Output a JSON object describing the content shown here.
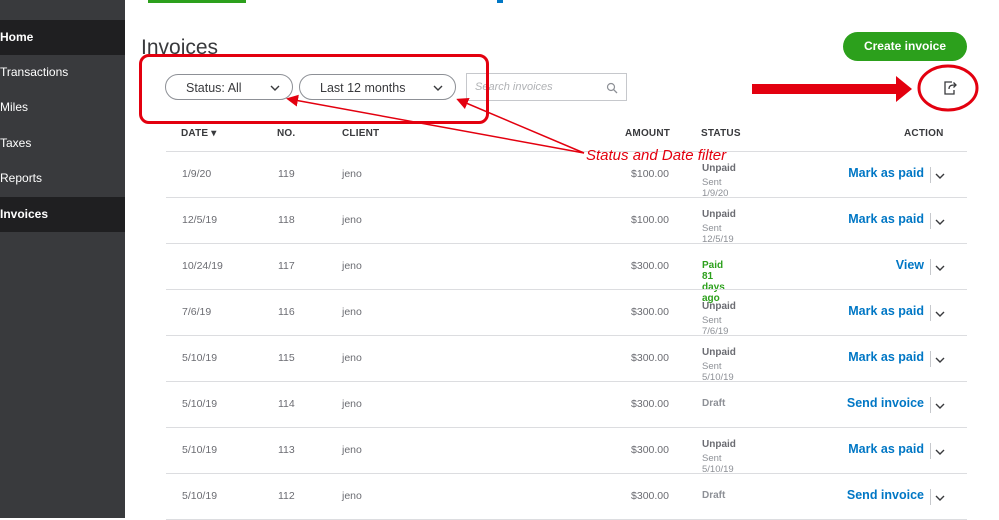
{
  "app": {
    "page_title": "Invoices",
    "create_button": "Create invoice"
  },
  "sidebar": {
    "items": [
      {
        "label": "Home"
      },
      {
        "label": "Transactions"
      },
      {
        "label": "Miles"
      },
      {
        "label": "Taxes"
      },
      {
        "label": "Reports"
      },
      {
        "label": "Invoices"
      }
    ]
  },
  "filters": {
    "status": "Status: All",
    "date_range": "Last 12 months",
    "search_placeholder": "Search invoices"
  },
  "table": {
    "columns": [
      "DATE ▾",
      "NO.",
      "CLIENT",
      "AMOUNT",
      "STATUS",
      "ACTION"
    ],
    "rows": [
      {
        "date": "1/9/20",
        "no": "119",
        "client": "jeno",
        "amount": "$100.00",
        "status": "Unpaid",
        "sub": "Sent 1/9/20",
        "action": "Mark as paid"
      },
      {
        "date": "12/5/19",
        "no": "118",
        "client": "jeno",
        "amount": "$100.00",
        "status": "Unpaid",
        "sub": "Sent 12/5/19",
        "action": "Mark as paid"
      },
      {
        "date": "10/24/19",
        "no": "117",
        "client": "jeno",
        "amount": "$300.00",
        "status": "Paid 81 days ago",
        "sub": "",
        "action": "View"
      },
      {
        "date": "7/6/19",
        "no": "116",
        "client": "jeno",
        "amount": "$300.00",
        "status": "Unpaid",
        "sub": "Sent 7/6/19",
        "action": "Mark as paid"
      },
      {
        "date": "5/10/19",
        "no": "115",
        "client": "jeno",
        "amount": "$300.00",
        "status": "Unpaid",
        "sub": "Sent 5/10/19",
        "action": "Mark as paid"
      },
      {
        "date": "5/10/19",
        "no": "114",
        "client": "jeno",
        "amount": "$300.00",
        "status": "Draft",
        "sub": "",
        "action": "Send invoice"
      },
      {
        "date": "5/10/19",
        "no": "113",
        "client": "jeno",
        "amount": "$300.00",
        "status": "Unpaid",
        "sub": "Sent 5/10/19",
        "action": "Mark as paid"
      },
      {
        "date": "5/10/19",
        "no": "112",
        "client": "jeno",
        "amount": "$300.00",
        "status": "Draft",
        "sub": "",
        "action": "Send invoice"
      }
    ]
  },
  "annotation": {
    "text": "Status and Date filter"
  },
  "colors": {
    "accent_green": "#2ca01c",
    "link_blue": "#0077c5",
    "annotation_red": "#e3000f",
    "sidebar_bg": "#393a3d"
  },
  "icons": {
    "export": "export-icon",
    "search": "search-icon",
    "chevron": "chevron-down-icon"
  }
}
